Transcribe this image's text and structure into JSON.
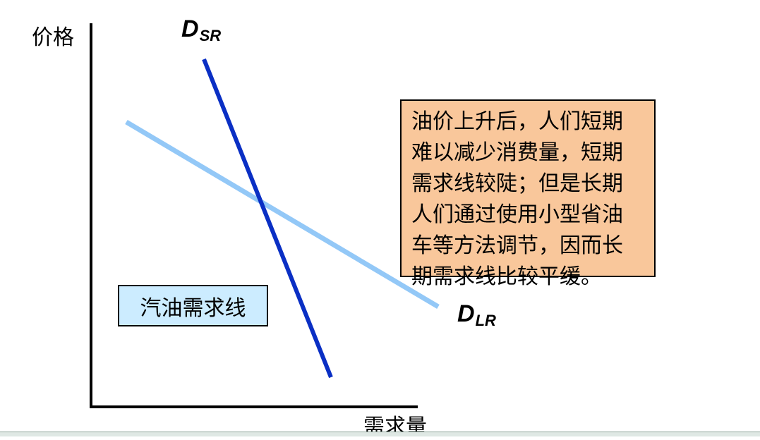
{
  "diagram": {
    "y_axis_label": "价格",
    "x_axis_label": "需求量",
    "curves": [
      {
        "id": "sr",
        "label_main": "D",
        "label_sub": "SR",
        "color": "#0a2fc4"
      },
      {
        "id": "lr",
        "label_main": "D",
        "label_sub": "LR",
        "color": "#93c8f7"
      }
    ],
    "note": {
      "lines": [
        "油价上升后，人们短期",
        "难以减少消费量，短期",
        "需求线较陡；但是长期",
        "人们通过使用小型省油",
        "车等方法调节，因而长",
        "期需求线比较平缓。"
      ],
      "background": "#f9c79b"
    },
    "name_box": {
      "text": "汽油需求线",
      "background": "#ccecff"
    }
  }
}
